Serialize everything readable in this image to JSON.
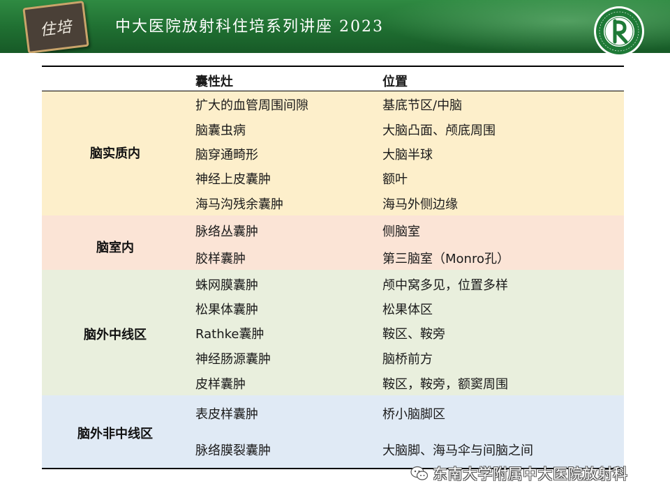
{
  "header": {
    "badge_text": "住培",
    "title": "中大医院放射科住培系列讲座 2023",
    "logo_icon": "hospital-seal-icon",
    "colors": {
      "banner": "#1f6e31",
      "badge_frame": "#c9a46a"
    }
  },
  "table": {
    "headers": {
      "lesion": "囊性灶",
      "location": "位置"
    },
    "groups": [
      {
        "label": "脑实质内",
        "color": "#fdefcb",
        "rows": [
          {
            "lesion": "扩大的血管周围间隙",
            "location": "基底节区/中脑"
          },
          {
            "lesion": "脑囊虫病",
            "location": "大脑凸面、颅底周围"
          },
          {
            "lesion": "脑穿通畸形",
            "location": "大脑半球"
          },
          {
            "lesion": "神经上皮囊肿",
            "location": "额叶"
          },
          {
            "lesion": "海马沟残余囊肿",
            "location": "海马外侧边缘"
          }
        ]
      },
      {
        "label": "脑室内",
        "color": "#fbe4d6",
        "rows": [
          {
            "lesion": "脉络丛囊肿",
            "location": "侧脑室"
          },
          {
            "lesion": "胶样囊肿",
            "location": "第三脑室（Monro孔）"
          }
        ]
      },
      {
        "label": "脑外中线区",
        "color": "#e9efdd",
        "rows": [
          {
            "lesion": "蛛网膜囊肿",
            "location": "颅中窝多见，位置多样"
          },
          {
            "lesion": "松果体囊肿",
            "location": "松果体区"
          },
          {
            "lesion": "Rathke囊肿",
            "location": "鞍区、鞍旁"
          },
          {
            "lesion": "神经肠源囊肿",
            "location": "脑桥前方"
          },
          {
            "lesion": "皮样囊肿",
            "location": "鞍区，鞍旁，额窦周围"
          }
        ]
      },
      {
        "label": "脑外非中线区",
        "color": "#e0eaf5",
        "rows": [
          {
            "lesion": "表皮样囊肿",
            "location": "桥小脑脚区"
          },
          {
            "lesion": "脉络膜裂囊肿",
            "location": "大脑脚、海马伞与间脑之间"
          }
        ]
      }
    ]
  },
  "watermark": {
    "icon": "wechat-icon",
    "text": "东南大学附属中大医院放射科"
  }
}
